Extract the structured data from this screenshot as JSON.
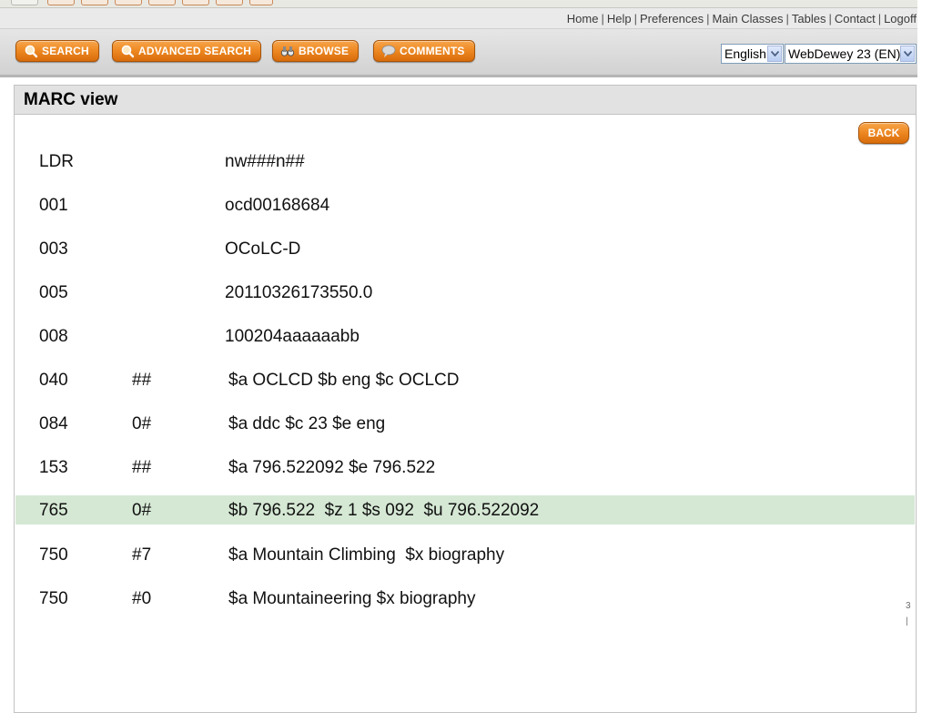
{
  "header_links": [
    {
      "label": "Home"
    },
    {
      "label": "Help"
    },
    {
      "label": "Preferences"
    },
    {
      "label": "Main Classes"
    },
    {
      "label": "Tables"
    },
    {
      "label": "Contact"
    },
    {
      "label": "Logoff"
    }
  ],
  "link_separator": "|",
  "toolbar": {
    "search": "Search",
    "advanced_search": "Advanced Search",
    "browse": "Browse",
    "comments": "Comments"
  },
  "language": {
    "selected": "English"
  },
  "edition": {
    "selected": "WebDewey 23 (EN)"
  },
  "panel": {
    "title": "MARC view",
    "back_label": "Back"
  },
  "records": [
    {
      "tag": "LDR",
      "ind": "",
      "value": "nw###n##"
    },
    {
      "tag": "001",
      "ind": "",
      "value": "ocd00168684"
    },
    {
      "tag": "003",
      "ind": "",
      "value": "OCoLC-D"
    },
    {
      "tag": "005",
      "ind": "",
      "value": "20110326173550.0"
    },
    {
      "tag": "008",
      "ind": "",
      "value": "100204aaaaaabb"
    },
    {
      "tag": "040",
      "ind": "##",
      "value": "$a OCLCD $b eng $c OCLCD"
    },
    {
      "tag": "084",
      "ind": "0#",
      "value": "$a ddc $c 23 $e eng"
    },
    {
      "tag": "153",
      "ind": "##",
      "value": "$a 796.522092 $e 796.522"
    },
    {
      "tag": "765",
      "ind": "0#",
      "value": "$b 796.522  $z 1 $s 092  $u 796.522092",
      "highlighted": true
    },
    {
      "tag": "750",
      "ind": "#7",
      "value": "$a Mountain Climbing  $x biography"
    },
    {
      "tag": "750",
      "ind": "#0",
      "value": "$a Mountaineering $x biography"
    }
  ],
  "edge_text": [
    "3",
    "|"
  ],
  "colors": {
    "accent_orange": "#ef8a24",
    "highlight_row": "#d5e8d4",
    "panel_header": "#e2e2e2"
  }
}
